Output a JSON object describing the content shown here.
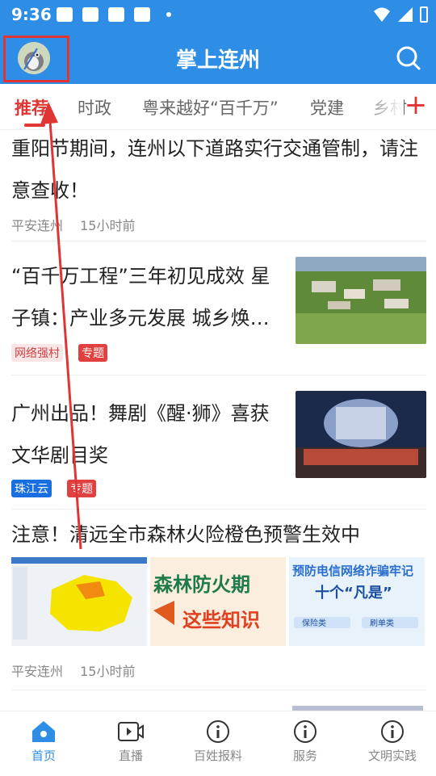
{
  "status_bar": {
    "time": "9:36"
  },
  "header": {
    "title": "掌上连州"
  },
  "tabs": [
    {
      "label": "推荐"
    },
    {
      "label": "时政"
    },
    {
      "label": "粤来越好“百千万”"
    },
    {
      "label": "党建"
    },
    {
      "label": "乡村"
    }
  ],
  "articles": [
    {
      "title": "重阳节期间，连州以下道路实行交通管制，请注意查收！",
      "source": "平安连州",
      "time": "15小时前"
    },
    {
      "title": "“百千万工程”三年初见成效 星子镇：产业多元发展 城乡焕…",
      "tags": [
        "网络强村",
        "专题"
      ]
    },
    {
      "title": "广州出品！舞剧《醒·狮》喜获文华剧目奖",
      "tags": [
        "珠江云",
        "专题"
      ]
    },
    {
      "title": "注意！清远全市森林火险橙色预警生效中",
      "source": "平安连州",
      "time": "15小时前",
      "image_texts": [
        "森林防火期",
        "这些知识",
        "预防电信网络诈骗牢记",
        "十个“凡是”",
        "保险类",
        "刷单类"
      ]
    }
  ],
  "bottom_nav": [
    {
      "label": "首页",
      "icon": "home-icon"
    },
    {
      "label": "直播",
      "icon": "live-video-icon"
    },
    {
      "label": "百姓报料",
      "icon": "info-icon"
    },
    {
      "label": "服务",
      "icon": "info-icon"
    },
    {
      "label": "文明实践",
      "icon": "info-icon"
    }
  ],
  "colors": {
    "brand": "#2e8ee6",
    "accent": "#e03535"
  }
}
